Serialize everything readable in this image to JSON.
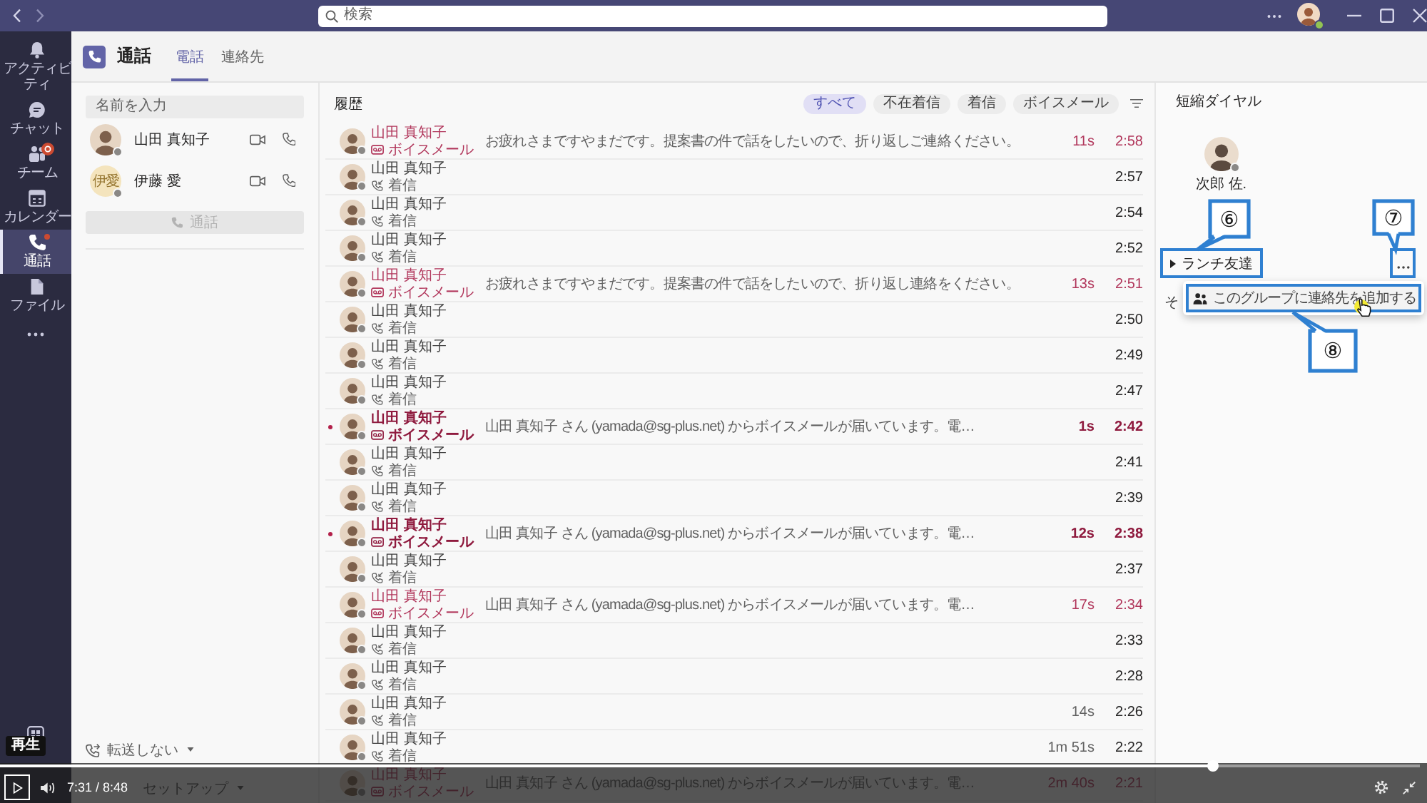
{
  "title_bar": {
    "search": {
      "placeholder": "検索"
    }
  },
  "rail": {
    "items": [
      {
        "kind": "activity",
        "label": "アクティビティ",
        "selected": false,
        "badge": false,
        "dot": false
      },
      {
        "kind": "chat",
        "label": "チャット",
        "selected": false,
        "badge": false,
        "dot": false
      },
      {
        "kind": "teams",
        "label": "チーム",
        "selected": false,
        "badge": true,
        "dot": false
      },
      {
        "kind": "calendar",
        "label": "カレンダー",
        "selected": false,
        "badge": false,
        "dot": false
      },
      {
        "kind": "calls",
        "label": "通話",
        "selected": true,
        "badge": false,
        "dot": true
      },
      {
        "kind": "files",
        "label": "ファイル",
        "selected": false,
        "badge": false,
        "dot": false
      }
    ]
  },
  "header": {
    "title": "通話",
    "tabs": [
      {
        "label": "電話",
        "selected": true
      },
      {
        "label": "連絡先",
        "selected": false
      }
    ]
  },
  "dial_panel": {
    "search": {
      "placeholder": "名前を入力"
    },
    "contacts": [
      {
        "kind": "photo",
        "name": "山田 真知子"
      },
      {
        "kind": "initials",
        "initials": "伊愛",
        "name": "伊藤 愛"
      }
    ],
    "call_button": {
      "label": "通話",
      "disabled": true
    },
    "forwarding": {
      "label": "転送しない"
    },
    "voicemail_setup": {
      "label": "セットアップ"
    }
  },
  "history": {
    "title": "履歴",
    "filters": [
      {
        "label": "すべて",
        "selected": true
      },
      {
        "label": "不在着信",
        "selected": false
      },
      {
        "label": "着信",
        "selected": false
      },
      {
        "label": "ボイスメール",
        "selected": false
      }
    ],
    "rows": [
      {
        "name": "山田 真知子",
        "kind": "voicemail",
        "type_label": "ボイスメール",
        "message": "お疲れさまですやまだです。提案書の件で話をしたいので、折り返しご連絡ください。",
        "duration": "11s",
        "time": "2:58",
        "unread": false
      },
      {
        "name": "山田 真知子",
        "kind": "incoming",
        "type_label": "着信",
        "time": "2:57",
        "unread": false
      },
      {
        "name": "山田 真知子",
        "kind": "incoming",
        "type_label": "着信",
        "time": "2:54",
        "unread": false
      },
      {
        "name": "山田 真知子",
        "kind": "incoming",
        "type_label": "着信",
        "time": "2:52",
        "unread": false
      },
      {
        "name": "山田 真知子",
        "kind": "voicemail",
        "type_label": "ボイスメール",
        "message": "お疲れさまですやまだです。提案書の件で話をしたいので、折り返し連絡をください。",
        "duration": "13s",
        "time": "2:51",
        "unread": false
      },
      {
        "name": "山田 真知子",
        "kind": "incoming",
        "type_label": "着信",
        "time": "2:50",
        "unread": false
      },
      {
        "name": "山田 真知子",
        "kind": "incoming",
        "type_label": "着信",
        "time": "2:49",
        "unread": false
      },
      {
        "name": "山田 真知子",
        "kind": "incoming",
        "type_label": "着信",
        "time": "2:47",
        "unread": false
      },
      {
        "name": "山田 真知子",
        "kind": "voicemail",
        "type_label": "ボイスメール",
        "message": "山田 真知子 さん (yamada@sg-plus.net) からボイスメールが届いています。電…",
        "duration": "1s",
        "time": "2:42",
        "unread": true
      },
      {
        "name": "山田 真知子",
        "kind": "incoming",
        "type_label": "着信",
        "time": "2:41",
        "unread": false
      },
      {
        "name": "山田 真知子",
        "kind": "incoming",
        "type_label": "着信",
        "time": "2:39",
        "unread": false
      },
      {
        "name": "山田 真知子",
        "kind": "voicemail",
        "type_label": "ボイスメール",
        "message": "山田 真知子 さん (yamada@sg-plus.net) からボイスメールが届いています。電…",
        "duration": "12s",
        "time": "2:38",
        "unread": true
      },
      {
        "name": "山田 真知子",
        "kind": "incoming",
        "type_label": "着信",
        "time": "2:37",
        "unread": false
      },
      {
        "name": "山田 真知子",
        "kind": "voicemail",
        "type_label": "ボイスメール",
        "message": "山田 真知子 さん (yamada@sg-plus.net) からボイスメールが届いています。電…",
        "duration": "17s",
        "time": "2:34",
        "unread": false
      },
      {
        "name": "山田 真知子",
        "kind": "incoming",
        "type_label": "着信",
        "time": "2:33",
        "unread": false
      },
      {
        "name": "山田 真知子",
        "kind": "incoming",
        "type_label": "着信",
        "time": "2:28",
        "unread": false
      },
      {
        "name": "山田 真知子",
        "kind": "incoming",
        "type_label": "着信",
        "duration": "14s",
        "time": "2:26",
        "unread": false
      },
      {
        "name": "山田 真知子",
        "kind": "incoming",
        "type_label": "着信",
        "duration": "1m 51s",
        "time": "2:22",
        "unread": false
      },
      {
        "name": "山田 真知子",
        "kind": "voicemail",
        "type_label": "ボイスメール",
        "message": "山田 真知子 さん (yamada@sg-plus.net) からボイスメールが届いています。電…",
        "duration": "2m 40s",
        "time": "2:21",
        "unread": false
      }
    ]
  },
  "speed_dial": {
    "title": "短縮ダイヤル",
    "contacts": [
      {
        "name": "次郎 佐."
      }
    ],
    "groups": [
      {
        "name": "ランチ友達",
        "expanded": false,
        "highlighted": true
      }
    ],
    "more_button": {
      "highlighted": true
    },
    "next_group": {
      "name": "そ"
    },
    "menu": {
      "items": [
        {
          "label": "このグループに連絡先を追加する",
          "highlighted": true
        }
      ]
    }
  },
  "annotations": [
    {
      "label": "⑥"
    },
    {
      "label": "⑦"
    },
    {
      "label": "⑧"
    }
  ],
  "player": {
    "tooltip": "再生",
    "time": "7:31 / 8:48",
    "level": 0.854
  }
}
